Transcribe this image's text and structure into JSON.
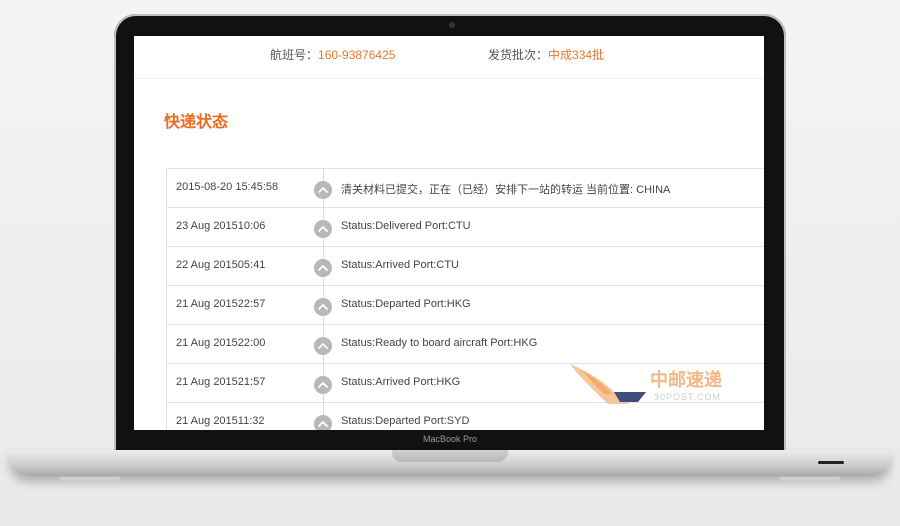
{
  "header": {
    "flight_label": "航班号：",
    "flight_value": "160-93876425",
    "batch_label": "发货批次：",
    "batch_value": "中成334批"
  },
  "section": {
    "title": "快递状态"
  },
  "tracking": {
    "rows": [
      {
        "time": "2015-08-20 15:45:58",
        "status": "清关材料已提交，正在（已经）安排下一站的转运 当前位置: CHINA"
      },
      {
        "time": "23 Aug 201510:06",
        "status": "Status:Delivered Port:CTU"
      },
      {
        "time": "22 Aug 201505:41",
        "status": "Status:Arrived Port:CTU"
      },
      {
        "time": "21 Aug 201522:57",
        "status": "Status:Departed Port:HKG"
      },
      {
        "time": "21 Aug 201522:00",
        "status": "Status:Ready to board aircraft Port:HKG"
      },
      {
        "time": "21 Aug 201521:57",
        "status": "Status:Arrived Port:HKG"
      },
      {
        "time": "21 Aug 201511:32",
        "status": "Status:Departed Port:SYD"
      }
    ],
    "icon": "chevron-up-icon"
  },
  "watermark": {
    "name": "中邮速递",
    "site": "30POST.COM"
  },
  "device": {
    "label": "MacBook Pro"
  },
  "colors": {
    "accent": "#ef6a1e",
    "value": "#e8772e",
    "icon_bg": "#b8b8b8"
  }
}
